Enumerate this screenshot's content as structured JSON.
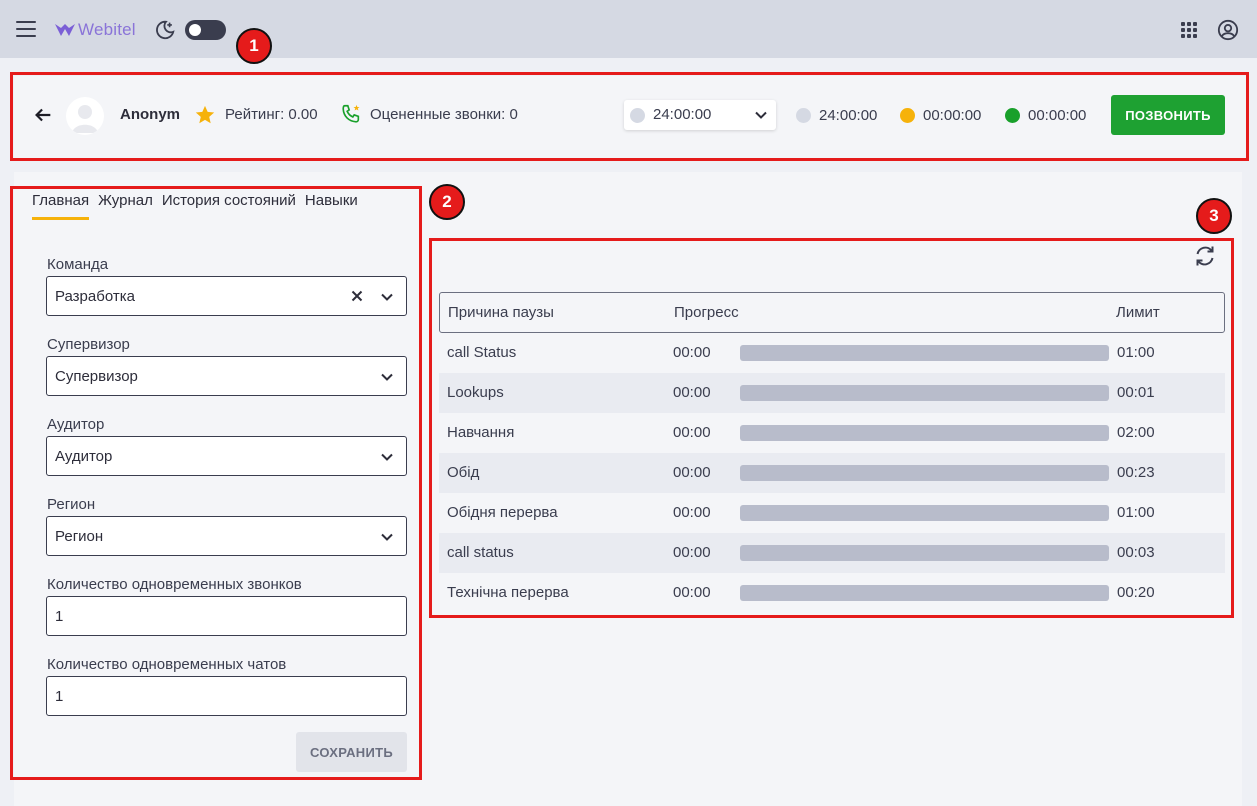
{
  "app": {
    "brand": "Webitel",
    "theme_dark": false
  },
  "annotations": [
    "1",
    "2",
    "3"
  ],
  "agent": {
    "name": "Anonym",
    "rating_label": "Рейтинг: 0.00",
    "rated_calls_label": "Оцененные звонки: 0",
    "status_select_value": "24:00:00",
    "timers": [
      {
        "value": "24:00:00",
        "color": "#d5d9e3"
      },
      {
        "value": "00:00:00",
        "color": "#f6b20b"
      },
      {
        "value": "00:00:00",
        "color": "#19a02b"
      }
    ],
    "call_button": "ПОЗВОНИТЬ"
  },
  "tabs": [
    "Главная",
    "Журнал",
    "История состояний",
    "Навыки"
  ],
  "active_tab": 0,
  "form": {
    "team_label": "Команда",
    "team_value": "Разработка",
    "supervisor_label": "Супервизор",
    "supervisor_value": "Супервизор",
    "auditor_label": "Аудитор",
    "auditor_value": "Аудитор",
    "region_label": "Регион",
    "region_value": "Регион",
    "calls_label": "Количество одновременных звонков",
    "calls_value": "1",
    "chats_label": "Количество одновременных чатов",
    "chats_value": "1",
    "save_button": "СОХРАНИТЬ"
  },
  "pause_table": {
    "headers": {
      "reason": "Причина паузы",
      "progress": "Прогресс",
      "limit": "Лимит"
    },
    "rows": [
      {
        "reason": "call Status",
        "progress": "00:00",
        "limit": "01:00",
        "fill": 0
      },
      {
        "reason": "Lookups",
        "progress": "00:00",
        "limit": "00:01",
        "fill": 0
      },
      {
        "reason": "Навчання",
        "progress": "00:00",
        "limit": "02:00",
        "fill": 0
      },
      {
        "reason": "Обід",
        "progress": "00:00",
        "limit": "00:23",
        "fill": 0
      },
      {
        "reason": "Обідня перерва",
        "progress": "00:00",
        "limit": "01:00",
        "fill": 0
      },
      {
        "reason": "call status",
        "progress": "00:00",
        "limit": "00:03",
        "fill": 0
      },
      {
        "reason": "Технічна перерва",
        "progress": "00:00",
        "limit": "00:20",
        "fill": 0
      }
    ]
  }
}
